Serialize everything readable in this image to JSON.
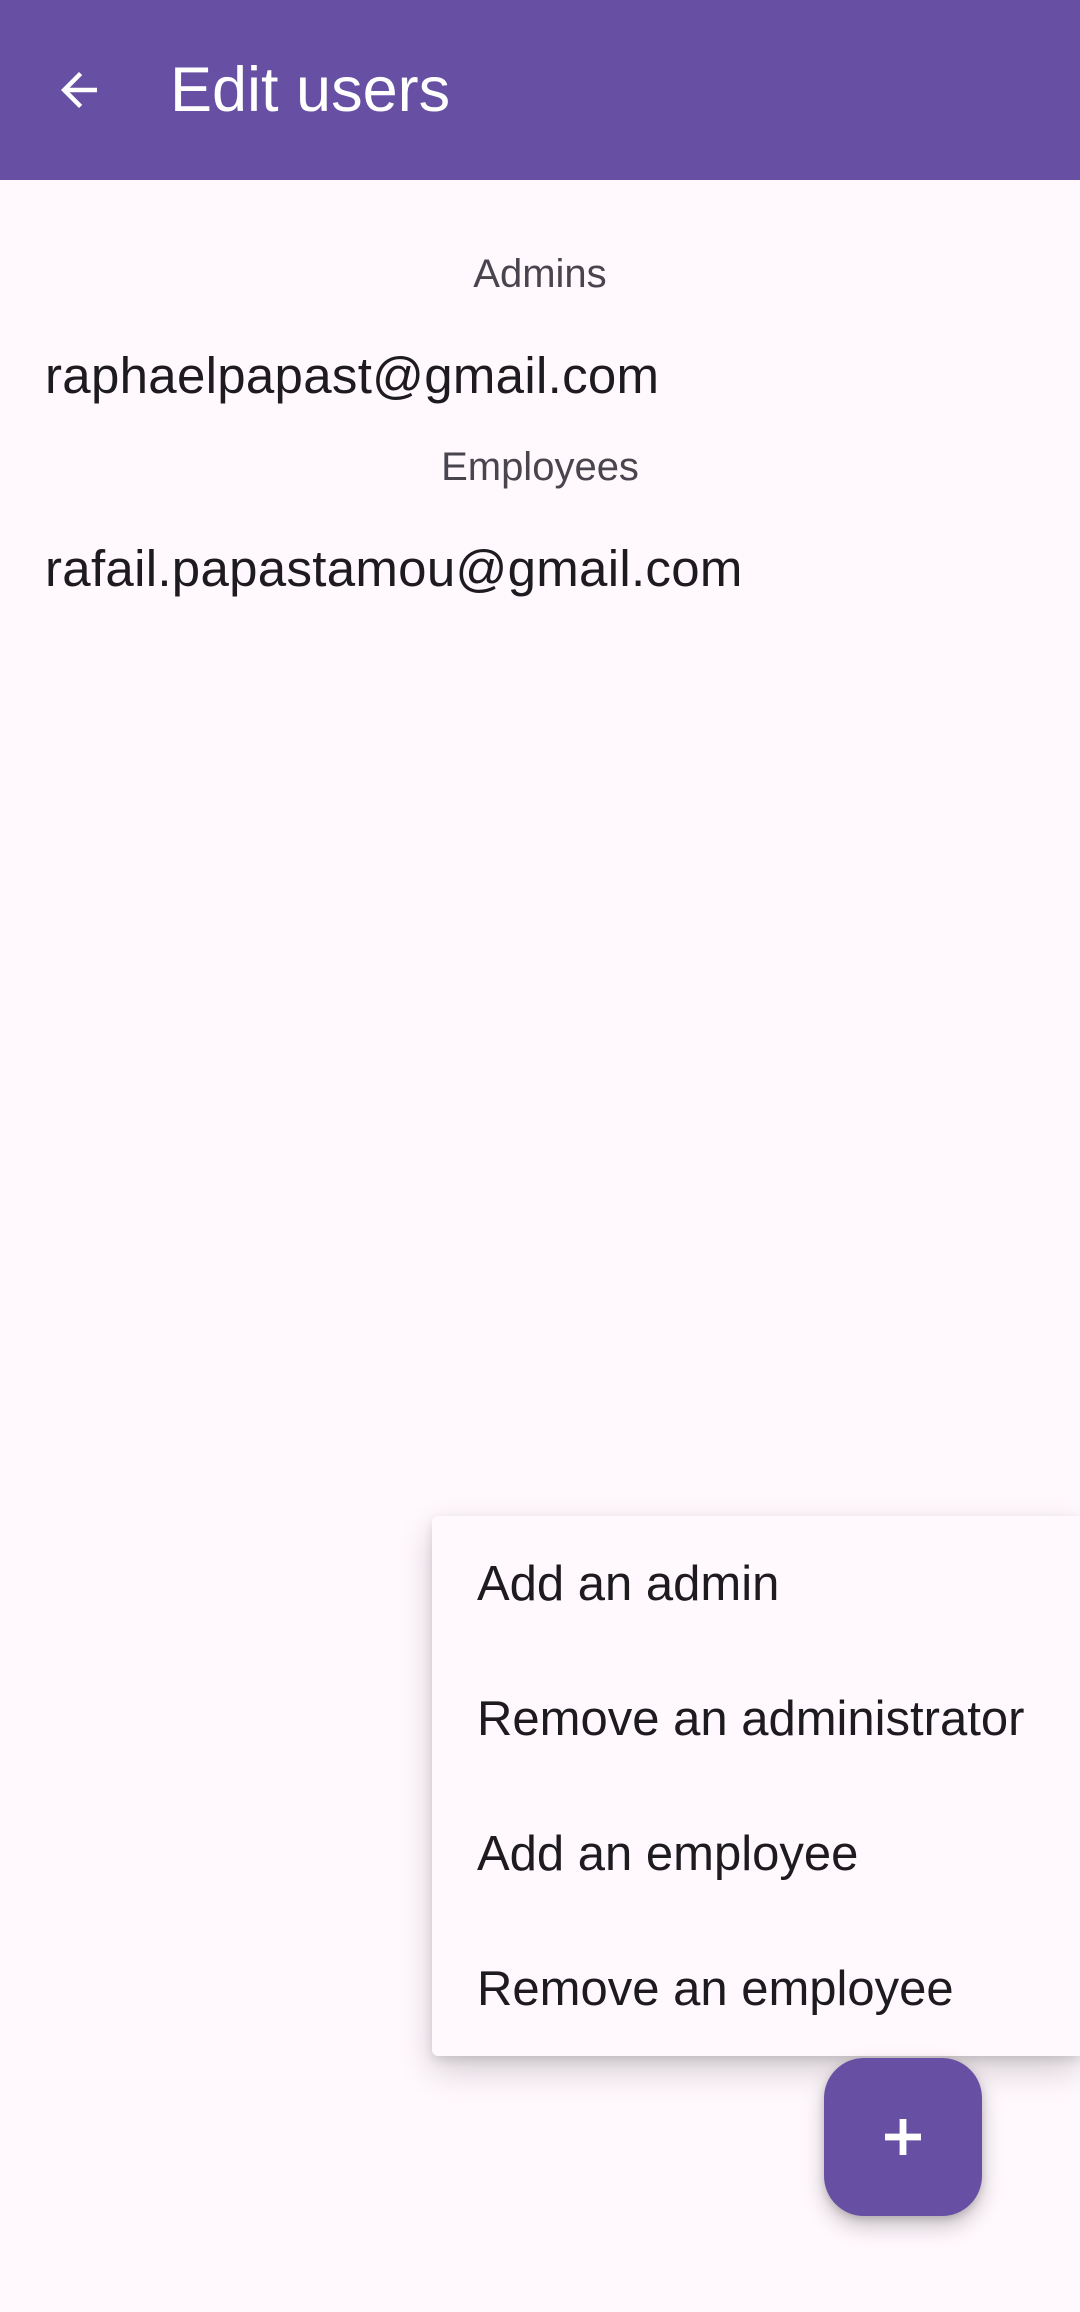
{
  "appbar": {
    "title": "Edit users",
    "back_icon": "arrow-back-icon",
    "background": "#6750A4"
  },
  "sections": {
    "admins_header": "Admins",
    "admins": [
      "raphaelpapast@gmail.com"
    ],
    "employees_header": "Employees",
    "employees": [
      "rafail.papastamou@gmail.com"
    ]
  },
  "menu": {
    "items": [
      {
        "label": "Add an admin"
      },
      {
        "label": "Remove an administrator"
      },
      {
        "label": "Add an employee"
      },
      {
        "label": "Remove an employee"
      }
    ]
  },
  "fab": {
    "icon": "plus-icon",
    "color": "#6750A4"
  }
}
